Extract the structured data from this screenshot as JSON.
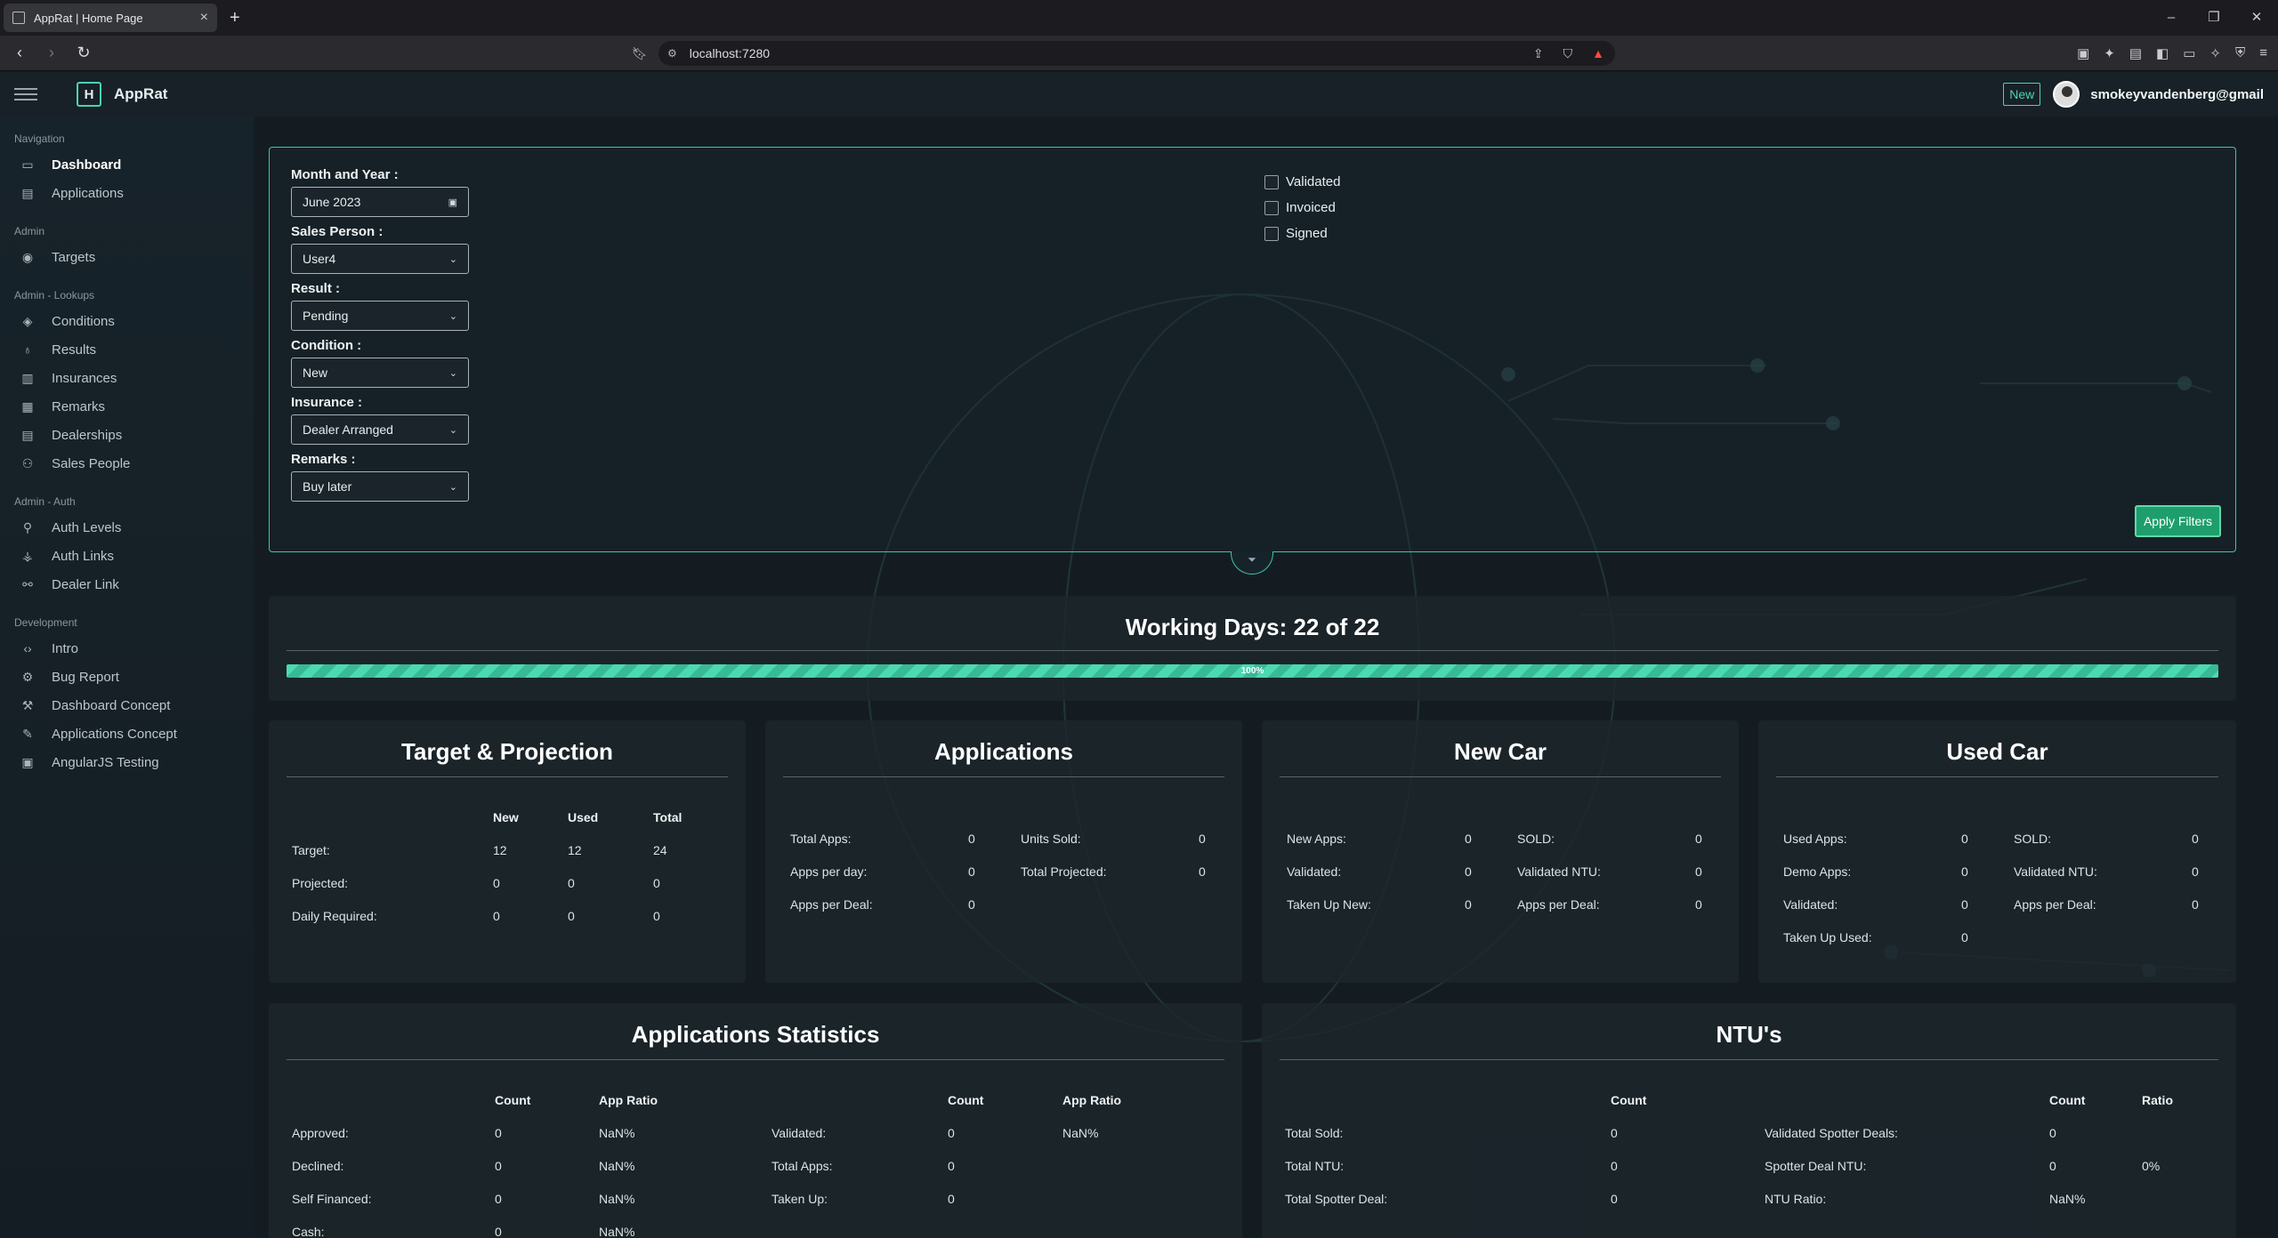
{
  "browser": {
    "tab_title": "AppRat | Home Page",
    "url": "localhost:7280"
  },
  "header": {
    "logo_letter": "H",
    "app_name": "AppRat",
    "new_badge": "New",
    "user_email": "smokeyvandenberg@gmail"
  },
  "sidebar": {
    "sections": [
      {
        "title": "Navigation",
        "items": [
          {
            "label": "Dashboard",
            "icon": "monitor-icon",
            "active": true
          },
          {
            "label": "Applications",
            "icon": "document-icon"
          }
        ]
      },
      {
        "title": "Admin",
        "items": [
          {
            "label": "Targets",
            "icon": "target-icon"
          }
        ]
      },
      {
        "title": "Admin - Lookups",
        "items": [
          {
            "label": "Conditions",
            "icon": "layers-icon"
          },
          {
            "label": "Results",
            "icon": "award-icon"
          },
          {
            "label": "Insurances",
            "icon": "building-icon"
          },
          {
            "label": "Remarks",
            "icon": "note-icon"
          },
          {
            "label": "Dealerships",
            "icon": "store-icon"
          },
          {
            "label": "Sales People",
            "icon": "users-icon"
          }
        ]
      },
      {
        "title": "Admin - Auth",
        "items": [
          {
            "label": "Auth Levels",
            "icon": "hierarchy-icon"
          },
          {
            "label": "Auth Links",
            "icon": "sitemap-icon"
          },
          {
            "label": "Dealer Link",
            "icon": "link-icon"
          }
        ]
      },
      {
        "title": "Development",
        "items": [
          {
            "label": "Intro",
            "icon": "code-icon"
          },
          {
            "label": "Bug Report",
            "icon": "bug-icon"
          },
          {
            "label": "Dashboard Concept",
            "icon": "wrench-icon"
          },
          {
            "label": "Applications Concept",
            "icon": "edit-icon"
          },
          {
            "label": "AngularJS Testing",
            "icon": "terminal-icon"
          }
        ]
      }
    ]
  },
  "filters": {
    "month_label": "Month and Year :",
    "month_value": "June 2023",
    "sales_label": "Sales Person :",
    "sales_value": "User4",
    "result_label": "Result :",
    "result_value": "Pending",
    "condition_label": "Condition :",
    "condition_value": "New",
    "insurance_label": "Insurance :",
    "insurance_value": "Dealer Arranged",
    "remarks_label": "Remarks :",
    "remarks_value": "Buy later",
    "checkboxes": [
      "Validated",
      "Invoiced",
      "Signed"
    ],
    "apply_label": "Apply Filters"
  },
  "working_days": {
    "title": "Working Days: 22 of 22",
    "progress_text": "100%",
    "progress_fraction": 1.0
  },
  "target_projection": {
    "title": "Target & Projection",
    "headers": [
      "New",
      "Used",
      "Total"
    ],
    "rows": [
      {
        "label": "Target:",
        "values": [
          "12",
          "12",
          "24"
        ]
      },
      {
        "label": "Projected:",
        "values": [
          "0",
          "0",
          "0"
        ]
      },
      {
        "label": "Daily Required:",
        "values": [
          "0",
          "0",
          "0"
        ]
      }
    ]
  },
  "applications": {
    "title": "Applications",
    "left": [
      {
        "k": "Total Apps:",
        "v": "0"
      },
      {
        "k": "Apps per day:",
        "v": "0"
      },
      {
        "k": "Apps per Deal:",
        "v": "0"
      }
    ],
    "right": [
      {
        "k": "Units Sold:",
        "v": "0"
      },
      {
        "k": "Total Projected:",
        "v": "0"
      }
    ]
  },
  "new_car": {
    "title": "New Car",
    "left": [
      {
        "k": "New Apps:",
        "v": "0"
      },
      {
        "k": "Validated:",
        "v": "0"
      },
      {
        "k": "Taken Up New:",
        "v": "0"
      }
    ],
    "right": [
      {
        "k": "SOLD:",
        "v": "0"
      },
      {
        "k": "Validated NTU:",
        "v": "0"
      },
      {
        "k": "Apps per Deal:",
        "v": "0"
      }
    ]
  },
  "used_car": {
    "title": "Used Car",
    "left": [
      {
        "k": "Used Apps:",
        "v": "0"
      },
      {
        "k": "Demo Apps:",
        "v": "0"
      },
      {
        "k": "Validated:",
        "v": "0"
      },
      {
        "k": "Taken Up Used:",
        "v": "0"
      }
    ],
    "right": [
      {
        "k": "SOLD:",
        "v": "0"
      },
      {
        "k": "Validated NTU:",
        "v": "0"
      },
      {
        "k": "Apps per Deal:",
        "v": "0"
      }
    ]
  },
  "app_stats": {
    "title": "Applications Statistics",
    "left_headers": [
      "Count",
      "App Ratio"
    ],
    "left_rows": [
      {
        "label": "Approved:",
        "count": "0",
        "ratio": "NaN%"
      },
      {
        "label": "Declined:",
        "count": "0",
        "ratio": "NaN%"
      },
      {
        "label": "Self Financed:",
        "count": "0",
        "ratio": "NaN%"
      },
      {
        "label": "Cash:",
        "count": "0",
        "ratio": "NaN%"
      }
    ],
    "right_headers": [
      "Count",
      "App Ratio"
    ],
    "right_rows": [
      {
        "label": "Validated:",
        "count": "0",
        "ratio": "NaN%"
      },
      {
        "label": "Total Apps:",
        "count": "0",
        "ratio": ""
      },
      {
        "label": "Taken Up:",
        "count": "0",
        "ratio": ""
      }
    ]
  },
  "ntu": {
    "title": "NTU's",
    "left_headers": [
      "Count"
    ],
    "left_rows": [
      {
        "label": "Total Sold:",
        "count": "0"
      },
      {
        "label": "Total NTU:",
        "count": "0"
      },
      {
        "label": "Total Spotter Deal:",
        "count": "0"
      }
    ],
    "right_headers": [
      "Count",
      "Ratio"
    ],
    "right_rows": [
      {
        "label": "Validated Spotter Deals:",
        "count": "0",
        "ratio": ""
      },
      {
        "label": "Spotter Deal NTU:",
        "count": "0",
        "ratio": "0%"
      },
      {
        "label": "NTU Ratio:",
        "count": "NaN%",
        "ratio": ""
      }
    ]
  },
  "colors": {
    "accent": "#3cc7a7",
    "background": "#141c22",
    "apply_button": "#1e9e6c"
  }
}
